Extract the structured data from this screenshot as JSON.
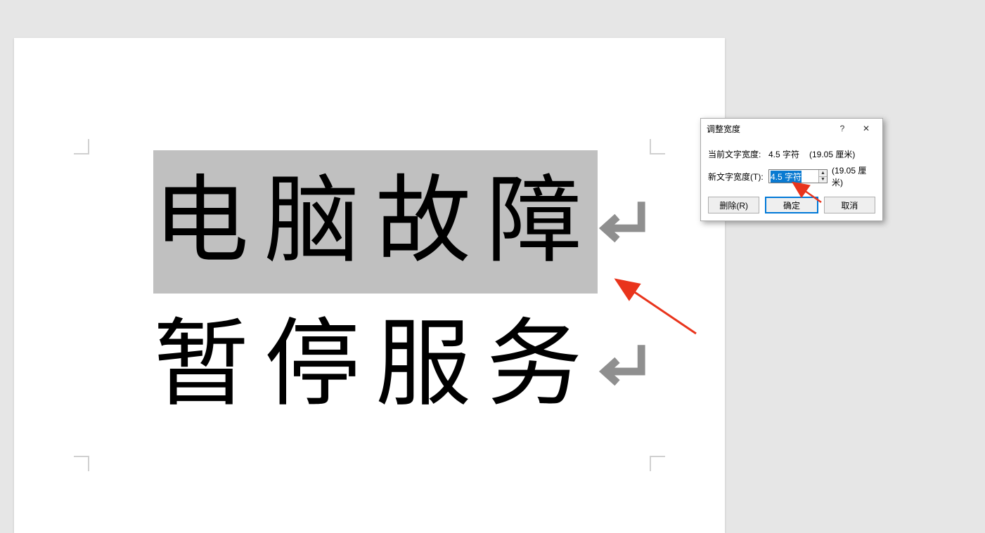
{
  "document": {
    "line1_text": "电脑故障",
    "line2_text": "暂停服务"
  },
  "dialog": {
    "title": "调整宽度",
    "current_width_label": "当前文字宽度:",
    "current_width_value": "4.5 字符",
    "current_width_extra": "(19.05 厘米)",
    "new_width_label": "新文字宽度(T):",
    "new_width_value": "4.5 字符",
    "new_width_extra": "(19.05 厘米)",
    "delete_label": "删除(R)",
    "ok_label": "确定",
    "cancel_label": "取消",
    "help_symbol": "?",
    "close_symbol": "✕"
  },
  "colors": {
    "arrow": "#e9341c",
    "para_mark": "#8f8f8f"
  }
}
